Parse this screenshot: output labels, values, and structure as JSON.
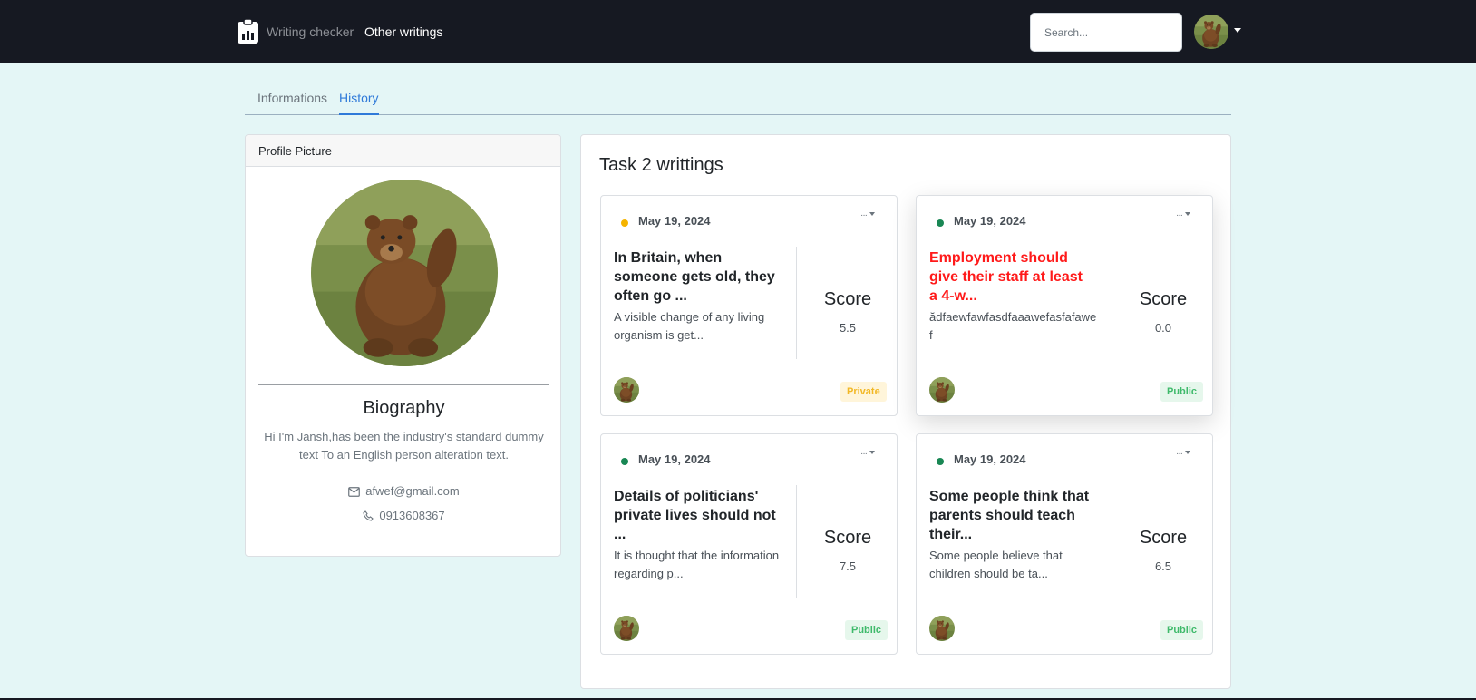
{
  "navbar": {
    "brand": "Writing checker",
    "link": "Other writings",
    "search_placeholder": "Search...",
    "icons": {
      "brand": "clipboard-chart-icon",
      "avatar": "bear-avatar",
      "caret": "caret-down-icon"
    }
  },
  "tabs": [
    {
      "label": "Informations",
      "active": false
    },
    {
      "label": "History",
      "active": true
    }
  ],
  "profile": {
    "header": "Profile Picture",
    "bio_title": "Biography",
    "bio_text": "Hi I'm Jansh,has been the industry's standard dummy text To an English person alteration text.",
    "email": "afwef@gmail.com",
    "phone": "0913608367"
  },
  "writings": {
    "title": "Task 2 writtings",
    "cards": [
      {
        "date": "May 19, 2024",
        "status_color": "#f5b400",
        "title": "In Britain, when someone gets old, they often go ...",
        "snippet": "A visible change of any living organism is get...",
        "score_label": "Score",
        "score": "5.5",
        "visibility": "Private"
      },
      {
        "date": "May 19, 2024",
        "status_color": "#198754",
        "title": "Employment should give their staff at least a 4-w...",
        "snippet": "ădfaewfawfasdfaaawefasfafawef",
        "score_label": "Score",
        "score": "0.0",
        "visibility": "Public"
      },
      {
        "date": "May 19, 2024",
        "status_color": "#198754",
        "title": "Details of politicians' private lives should not ...",
        "snippet": "It is thought that the information regarding p...",
        "score_label": "Score",
        "score": "7.5",
        "visibility": "Public"
      },
      {
        "date": "May 19, 2024",
        "status_color": "#198754",
        "title": "Some people think that parents should teach their...",
        "snippet": "Some people believe that children should be ta...",
        "score_label": "Score",
        "score": "6.5",
        "visibility": "Public"
      }
    ]
  }
}
